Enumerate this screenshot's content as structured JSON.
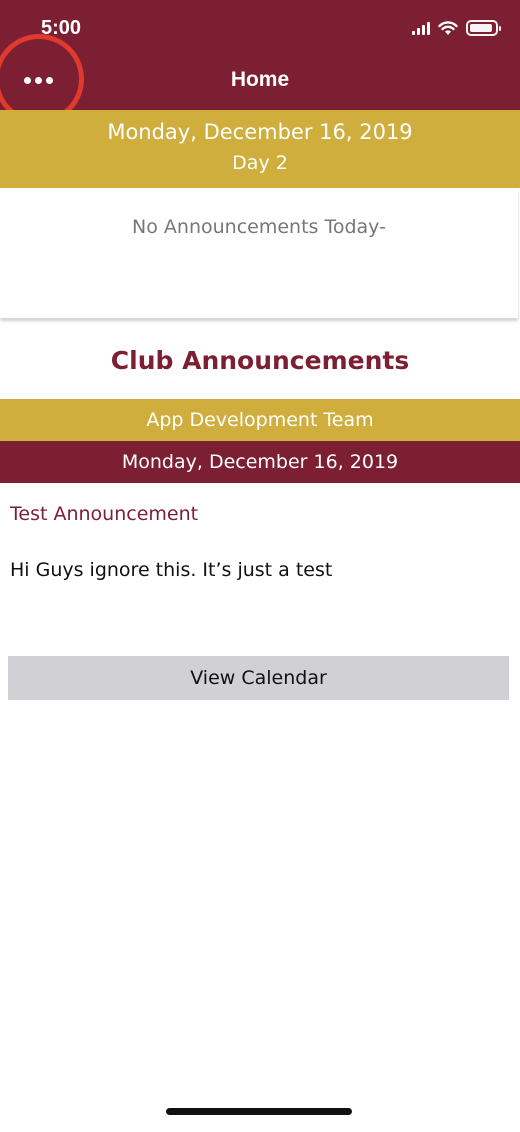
{
  "status_bar": {
    "time": "5:00"
  },
  "header": {
    "title": "Home",
    "menu_icon": "ellipsis-icon",
    "accent": "#7c1f32",
    "highlight": "#e03a2f"
  },
  "date_banner": {
    "date": "Monday, December 16, 2019",
    "day": "Day 2",
    "color": "#cfae3e"
  },
  "today": {
    "message": "No Announcements Today-"
  },
  "club": {
    "heading": "Club Announcements",
    "name": "App Development Team",
    "date": "Monday, December 16, 2019",
    "announcement_title": "Test Announcement",
    "announcement_body": "Hi Guys ignore this. It’s just a test"
  },
  "actions": {
    "view_calendar": "View Calendar"
  }
}
